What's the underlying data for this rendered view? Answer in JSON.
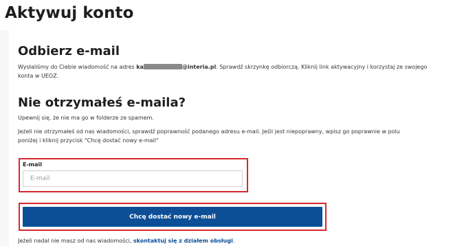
{
  "page_title": "Aktywuj konto",
  "received_section": {
    "heading": "Odbierz e-mail",
    "text_before_email": "Wysłaliśmy do Ciebie wiadomość na adres ",
    "email_prefix": "ka",
    "email_suffix": "@interia.pl",
    "text_after_email": ". Sprawdź skrzynkę odbiorczą. Kliknij link aktywacyjny i korzystaj ze swojego",
    "text_line2": "konta w UEOZ."
  },
  "not_received_section": {
    "heading": "Nie otrzymałeś e-maila?",
    "hint": "Upewnij się, że nie ma go w folderze ze spamem.",
    "instruction_line1": "Jeżeli nie otrzymałeś od nas wiadomości, sprawdź poprawność podanego adresu e-mail. Jeśli jest niepoprawny, wpisz go poprawnie w polu",
    "instruction_line2": "poniżej i kliknij przycisk \"Chcę dostać nowy e-mail\""
  },
  "email_field": {
    "label": "E-mail",
    "value": "",
    "placeholder": "E-mail"
  },
  "submit_button": {
    "label": "Chcę dostać nowy e-mail"
  },
  "footer": {
    "text": "Jeżeli nadal nie masz od nas wiadomości, ",
    "link_label": "skontaktuj się z działem obsługi",
    "text_end": "."
  },
  "colors": {
    "highlight_border": "#d7262e",
    "primary_button": "#0d4f97",
    "link": "#0d4f97"
  }
}
